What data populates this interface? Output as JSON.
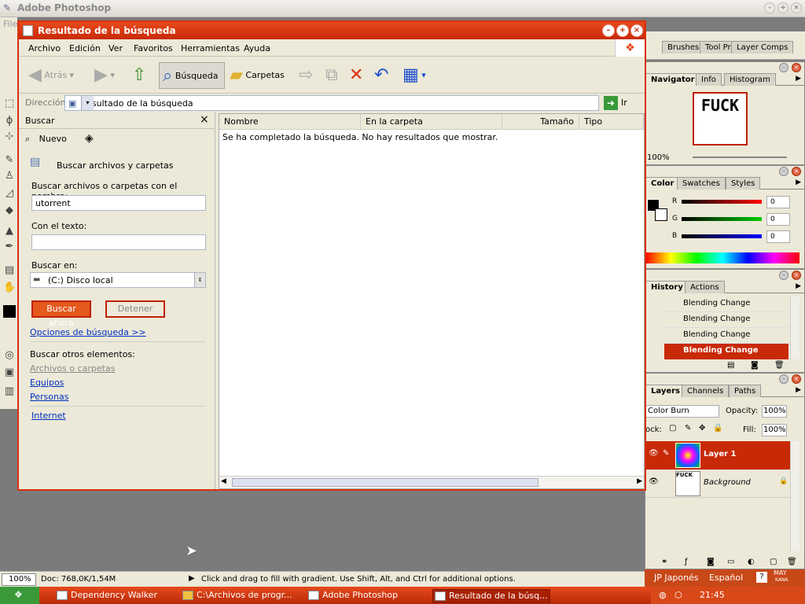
{
  "photoshop": {
    "title": "Adobe Photoshop",
    "menu_fragment": "File",
    "options_tabs": [
      "Brushes",
      "Tool Pr",
      "Layer Comps"
    ],
    "navigator": {
      "tabs": [
        "Navigator",
        "Info",
        "Histogram"
      ],
      "zoom": "100%",
      "thumb_text": "FUCK"
    },
    "color": {
      "tabs": [
        "Color",
        "Swatches",
        "Styles"
      ],
      "channels": [
        {
          "label": "R",
          "value": "0"
        },
        {
          "label": "G",
          "value": "0"
        },
        {
          "label": "B",
          "value": "0"
        }
      ]
    },
    "history": {
      "tabs": [
        "History",
        "Actions"
      ],
      "items": [
        "Blending Change",
        "Blending Change",
        "Blending Change",
        "Blending Change"
      ]
    },
    "layers": {
      "tabs": [
        "Layers",
        "Channels",
        "Paths"
      ],
      "blend_mode": "Color Burn",
      "opacity_label": "Opacity:",
      "opacity": "100%",
      "lock_label": "ock:",
      "fill_label": "Fill:",
      "fill": "100%",
      "items": [
        {
          "name": "Layer 1"
        },
        {
          "name": "Background"
        }
      ]
    },
    "status": {
      "zoom": "100%",
      "doc": "Doc: 768,0K/1,54M",
      "hint": "Click and drag to fill with gradient.  Use Shift, Alt, and Ctrl for additional options."
    }
  },
  "explorer": {
    "title": "Resultado de la búsqueda",
    "menu": [
      "Archivo",
      "Edición",
      "Ver",
      "Favoritos",
      "Herramientas",
      "Ayuda"
    ],
    "toolbar": {
      "back": "Atrás",
      "search": "Búsqueda",
      "folders": "Carpetas"
    },
    "address": {
      "label": "Dirección",
      "value": "Resultado de la búsqueda",
      "go": "Ir"
    },
    "search_pane": {
      "title": "Buscar",
      "new": "Nuevo",
      "heading": "Buscar archivos y carpetas",
      "name_label": "Buscar archivos o carpetas con el nombre:",
      "name_value": "utorrent",
      "text_label": "Con el texto:",
      "text_value": "",
      "in_label": "Buscar en:",
      "in_value": "(C:) Disco local",
      "search_now": "Buscar ahora",
      "stop": "Detener",
      "options": "Opciones de búsqueda  >>",
      "other_label": "Buscar otros elementos:",
      "other_links": [
        "Archivos o carpetas",
        "Equipos",
        "Personas"
      ],
      "internet": "Internet"
    },
    "results": {
      "columns": [
        "Nombre",
        "En la carpeta",
        "Tamaño",
        "Tipo"
      ],
      "message": "Se ha completado la búsqueda. No hay resultados que mostrar."
    }
  },
  "taskbar": {
    "items": [
      "Dependency Walker",
      "C:\\Archivos de progr...",
      "Adobe Photoshop",
      "Resultado de la búsq..."
    ],
    "lang_jp": "JP Japonés",
    "lang_es": "Español",
    "ime": "MAY",
    "ime_sub": "KANA",
    "time": "21:45"
  }
}
